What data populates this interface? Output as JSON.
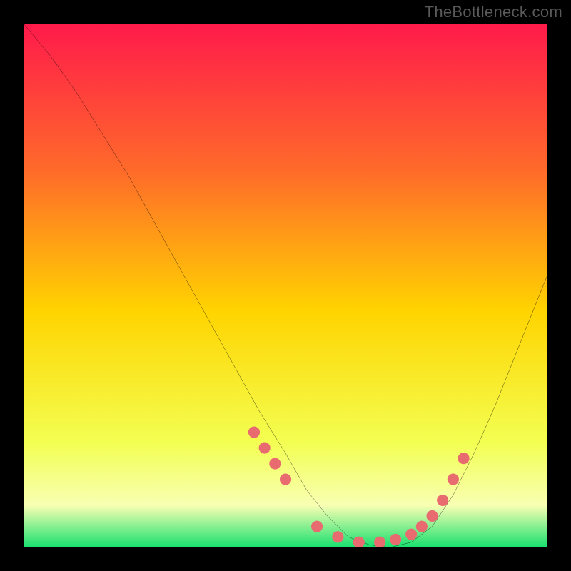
{
  "watermark": "TheBottleneck.com",
  "chart_data": {
    "type": "line",
    "title": "",
    "xlabel": "",
    "ylabel": "",
    "xlim": [
      0,
      100
    ],
    "ylim": [
      0,
      100
    ],
    "gradient_colors": {
      "top": "#ff1a4b",
      "mid_high": "#ff6a2a",
      "mid": "#ffd400",
      "mid_low": "#f3ff52",
      "band": "#f8ffb3",
      "bottom": "#17e06e"
    },
    "series": [
      {
        "name": "bottleneck-curve",
        "x": [
          0,
          5,
          10,
          15,
          20,
          25,
          30,
          35,
          40,
          45,
          50,
          54,
          58,
          62,
          66,
          70,
          74,
          78,
          82,
          86,
          90,
          94,
          98,
          100
        ],
        "y": [
          100,
          94,
          87,
          79,
          71,
          62,
          53,
          44,
          35,
          26,
          18,
          11,
          6,
          2,
          0.5,
          0,
          1,
          4,
          10,
          18,
          27,
          37,
          47,
          52
        ]
      }
    ],
    "markers": {
      "name": "highlight-points",
      "color": "#e86b6f",
      "x": [
        44,
        46,
        48,
        50,
        56,
        60,
        64,
        68,
        71,
        74,
        76,
        78,
        80,
        82,
        84
      ],
      "y": [
        22,
        19,
        16,
        13,
        4,
        2,
        1,
        1,
        1.5,
        2.5,
        4,
        6,
        9,
        13,
        17
      ]
    }
  }
}
